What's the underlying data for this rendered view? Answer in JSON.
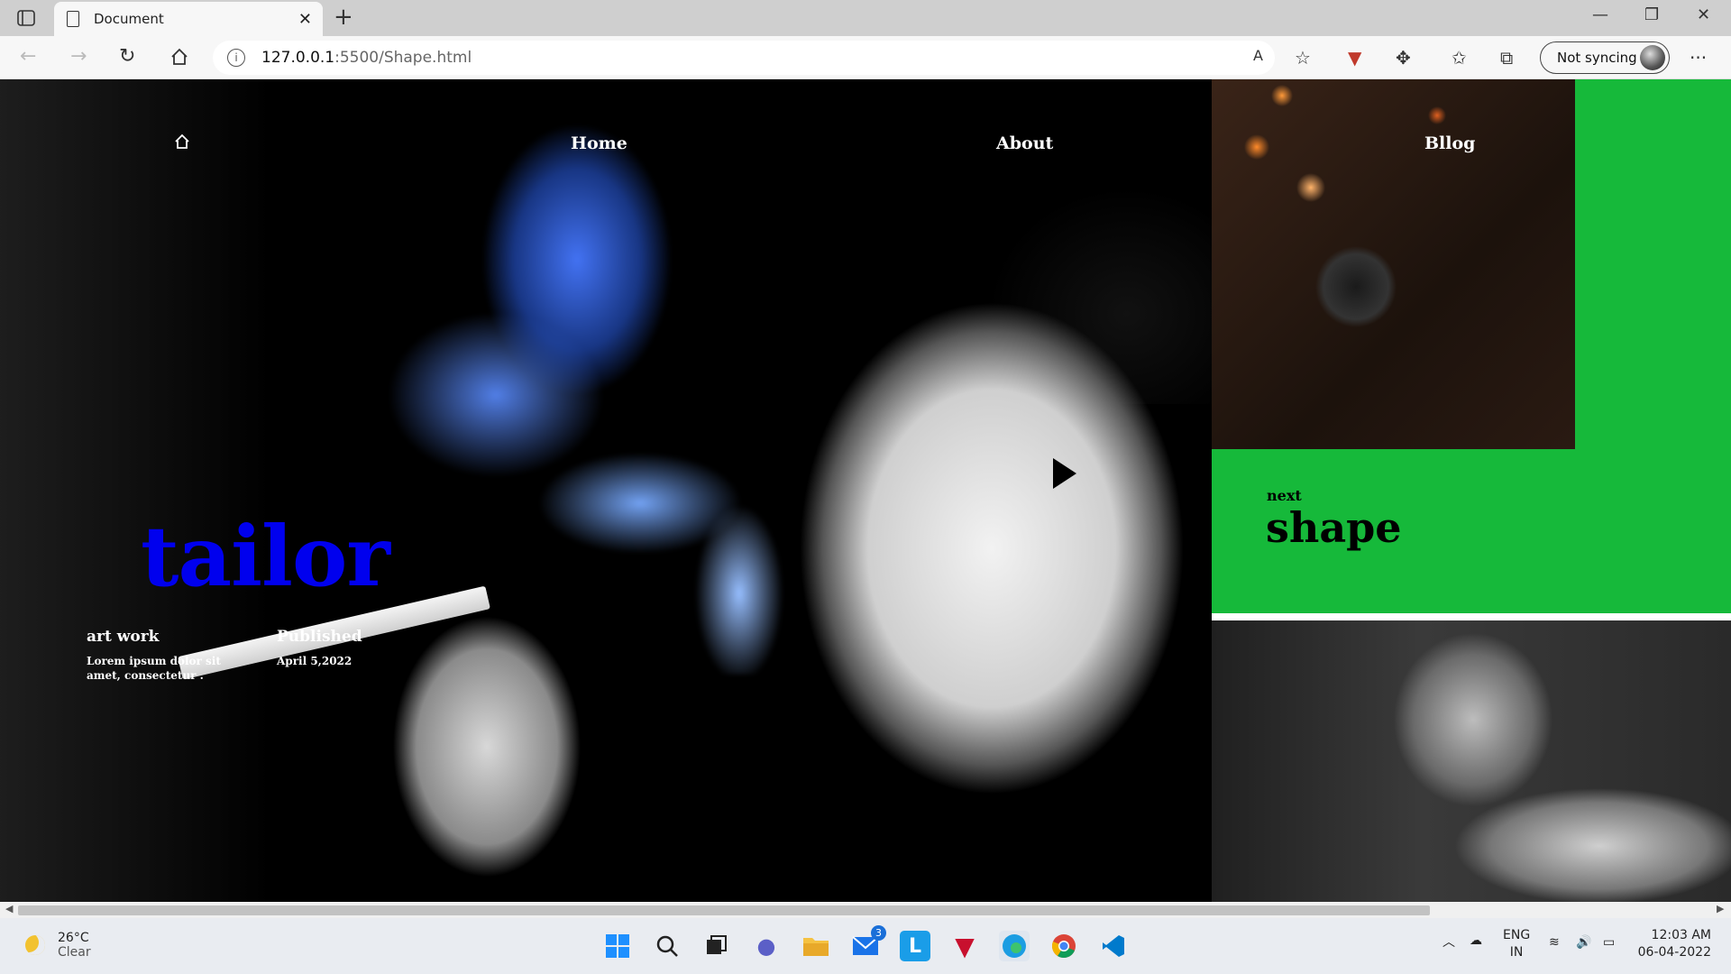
{
  "browser": {
    "tab_title": "Document",
    "tab_close": "✕",
    "new_tab": "+",
    "url_host": "127.0.0.1",
    "url_path": ":5500/Shape.html",
    "sync_label": "Not syncing",
    "more": "···",
    "minimize": "—",
    "restore": "❐",
    "close": "✕"
  },
  "page": {
    "nav": {
      "home_icon": "home-icon",
      "home": "Home",
      "about": "About",
      "blog": "Bllog"
    },
    "title": "tailor",
    "meta": {
      "art_heading": "art work",
      "art_text": "Lorem ipsum dolor sit amet, consectetur .",
      "pub_heading": "Published",
      "pub_date": "April 5,2022"
    },
    "side": {
      "next_label": "next",
      "shape_label": "shape"
    },
    "colors": {
      "title": "#0000ee",
      "green": "#16b93a"
    }
  },
  "taskbar": {
    "weather_temp": "26°C",
    "weather_desc": "Clear",
    "mail_badge": "3",
    "lang_top": "ENG",
    "lang_bottom": "IN",
    "time": "12:03 AM",
    "date": "06-04-2022"
  }
}
